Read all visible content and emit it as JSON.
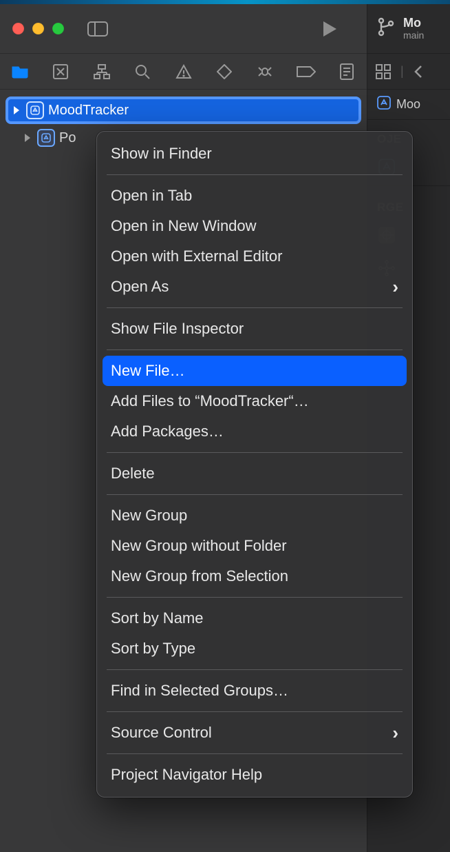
{
  "branch": {
    "title": "Mo",
    "subtitle": "main"
  },
  "tree": {
    "items": [
      {
        "label": "MoodTracker",
        "selected": true
      },
      {
        "label": "Po"
      }
    ]
  },
  "right": {
    "crumb": "Moo",
    "section1": "OJE",
    "section2": "RGE",
    "proj_item": ""
  },
  "context_menu": {
    "items": [
      {
        "label": "Show in Finder"
      },
      {
        "sep": true
      },
      {
        "label": "Open in Tab"
      },
      {
        "label": "Open in New Window"
      },
      {
        "label": "Open with External Editor"
      },
      {
        "label": "Open As",
        "submenu": true
      },
      {
        "sep": true
      },
      {
        "label": "Show File Inspector"
      },
      {
        "sep": true
      },
      {
        "label": "New File…",
        "highlight": true
      },
      {
        "label": "Add Files to “MoodTracker“…"
      },
      {
        "label": "Add Packages…"
      },
      {
        "sep": true
      },
      {
        "label": "Delete"
      },
      {
        "sep": true
      },
      {
        "label": "New Group"
      },
      {
        "label": "New Group without Folder"
      },
      {
        "label": "New Group from Selection"
      },
      {
        "sep": true
      },
      {
        "label": "Sort by Name"
      },
      {
        "label": "Sort by Type"
      },
      {
        "sep": true
      },
      {
        "label": "Find in Selected Groups…"
      },
      {
        "sep": true
      },
      {
        "label": "Source Control",
        "submenu": true
      },
      {
        "sep": true
      },
      {
        "label": "Project Navigator Help"
      }
    ]
  }
}
